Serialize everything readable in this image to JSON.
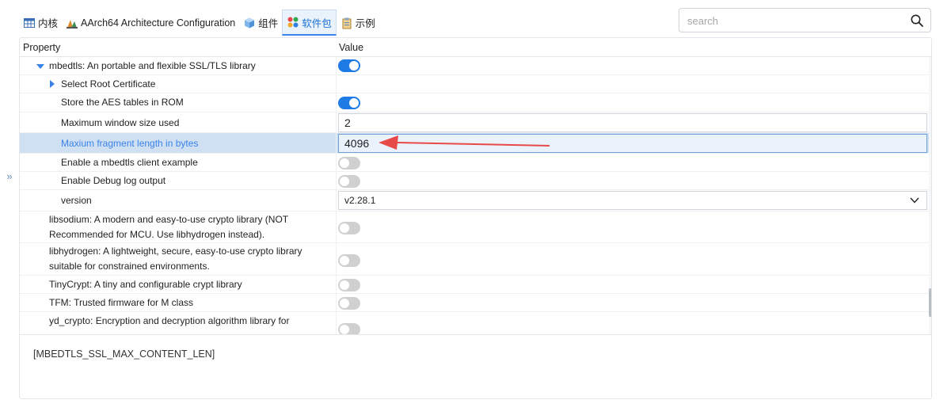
{
  "tabs": [
    {
      "label": "内核",
      "icon": "table-icon"
    },
    {
      "label": "AArch64 Architecture Configuration",
      "icon": "architecture-icon"
    },
    {
      "label": "组件",
      "icon": "cube-icon"
    },
    {
      "label": "软件包",
      "icon": "packages-icon",
      "active": true
    },
    {
      "label": "示例",
      "icon": "example-icon"
    }
  ],
  "search": {
    "placeholder": "search",
    "value": ""
  },
  "table": {
    "headers": {
      "property": "Property",
      "value": "Value"
    },
    "rows": [
      {
        "label": "mbedtls: An portable and flexible SSL/TLS library",
        "type": "toggle",
        "on": true,
        "expander": "expanded"
      },
      {
        "label": "Select Root Certificate",
        "type": "none",
        "expander": "collapsed"
      },
      {
        "label": "Store the AES tables in ROM",
        "type": "toggle",
        "on": true
      },
      {
        "label": "Maximum window size used",
        "type": "text",
        "value": "2"
      },
      {
        "label": "Maxium fragment length in bytes",
        "type": "text",
        "value": "4096",
        "selected": true
      },
      {
        "label": "Enable a mbedtls client example",
        "type": "toggle",
        "on": false
      },
      {
        "label": "Enable Debug log output",
        "type": "toggle",
        "on": false
      },
      {
        "label": "version",
        "type": "select",
        "value": "v2.28.1"
      },
      {
        "label_lines": [
          "libsodium: A modern and easy-to-use crypto library (NOT",
          "Recommended for MCU. Use libhydrogen instead)."
        ],
        "type": "toggle",
        "on": false
      },
      {
        "label_lines": [
          "libhydrogen: A lightweight, secure, easy-to-use crypto library",
          "suitable for constrained environments."
        ],
        "type": "toggle",
        "on": false
      },
      {
        "label": "TinyCrypt: A tiny and configurable crypt library",
        "type": "toggle",
        "on": false
      },
      {
        "label": "TFM: Trusted firmware for M class",
        "type": "toggle",
        "on": false
      },
      {
        "label": "yd_crypto: Encryption and decryption algorithm library for",
        "type": "toggle",
        "on": false
      }
    ]
  },
  "description": "[MBEDTLS_SSL_MAX_CONTENT_LEN]",
  "colors": {
    "accent": "#1e7be6",
    "selected_row": "#cfe0f3",
    "annotation_arrow": "#e84a4a"
  }
}
